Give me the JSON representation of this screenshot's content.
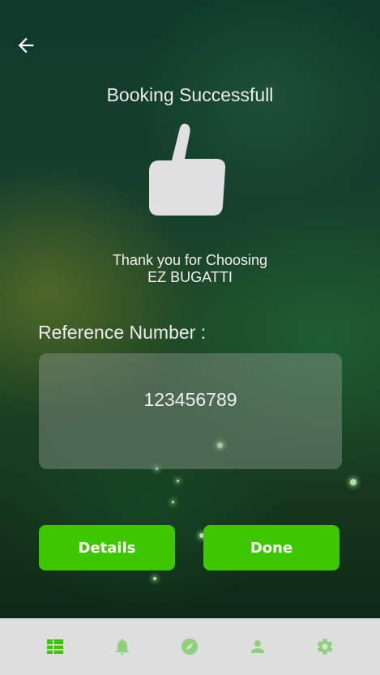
{
  "header": {
    "title": "Booking Successfull"
  },
  "message": {
    "line1": "Thank you for Choosing",
    "line2": "EZ BUGATTI"
  },
  "reference": {
    "label": "Reference Number :",
    "value": "123456789"
  },
  "buttons": {
    "details_label": "Details",
    "done_label": "Done"
  },
  "bottom_nav": {
    "items": [
      {
        "name": "dashboard",
        "icon": "dashboard-icon",
        "active": true
      },
      {
        "name": "notifications",
        "icon": "bell-icon",
        "active": false
      },
      {
        "name": "explore",
        "icon": "compass-icon",
        "active": false
      },
      {
        "name": "profile",
        "icon": "person-icon",
        "active": false
      },
      {
        "name": "settings",
        "icon": "gear-icon",
        "active": false
      }
    ]
  },
  "colors": {
    "accent": "#3ec700",
    "nav_active": "#3ec700",
    "nav_inactive": "#8fd07a",
    "nav_background": "#dedede"
  }
}
